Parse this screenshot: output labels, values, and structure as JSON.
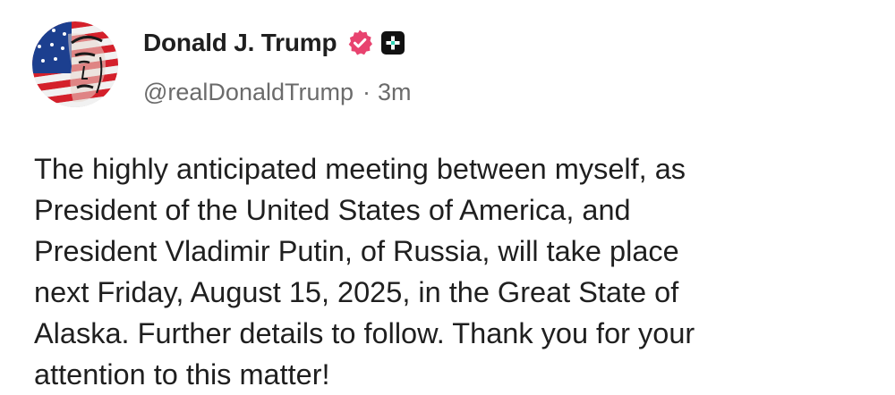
{
  "author": {
    "display_name": "Donald J. Trump",
    "handle": "@realDonaldTrump",
    "separator": "·",
    "timestamp": "3m",
    "avatar_icon": "avatar-flag-portrait",
    "verified_icon": "verified-badge-icon",
    "verified_color": "#e8436f",
    "plus_badge_icon": "plus-badge-icon"
  },
  "post": {
    "text": "The highly anticipated meeting between myself, as\nPresident of the United States of America, and\nPresident Vladimir Putin, of Russia, will take place\nnext Friday, August 15, 2025, in the Great State of\nAlaska. Further details to follow. Thank you for your\nattention to this matter!"
  },
  "colors": {
    "text_primary": "#1f1f1f",
    "text_secondary": "#6b6b6b",
    "background": "#ffffff"
  }
}
